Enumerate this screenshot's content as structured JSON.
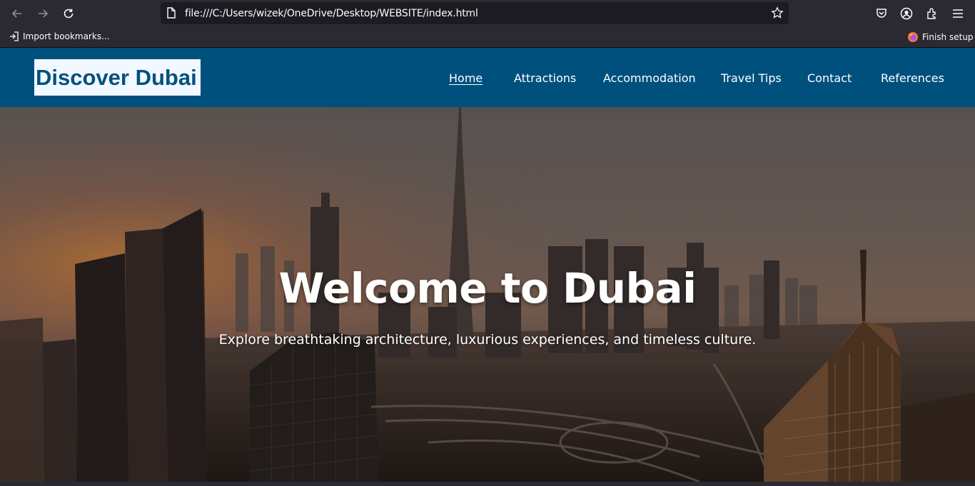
{
  "browser": {
    "url": "file:///C:/Users/wizek/OneDrive/Desktop/WEBSITE/index.html",
    "bookmarks": {
      "import_label": "Import bookmarks..."
    },
    "finish_setup_label": "Finish setup"
  },
  "site": {
    "logo": "Discover Dubai",
    "nav": [
      {
        "label": "Home",
        "active": true
      },
      {
        "label": "Attractions"
      },
      {
        "label": "Accommodation"
      },
      {
        "label": "Travel Tips"
      },
      {
        "label": "Contact"
      },
      {
        "label": "References"
      }
    ],
    "hero": {
      "title": "Welcome to Dubai",
      "subtitle": "Explore breathtaking architecture, luxurious experiences, and timeless culture."
    }
  },
  "colors": {
    "header_bg": "#00507e",
    "logo_bg": "#f2f8ff",
    "chrome_bg": "#2b2a33"
  }
}
